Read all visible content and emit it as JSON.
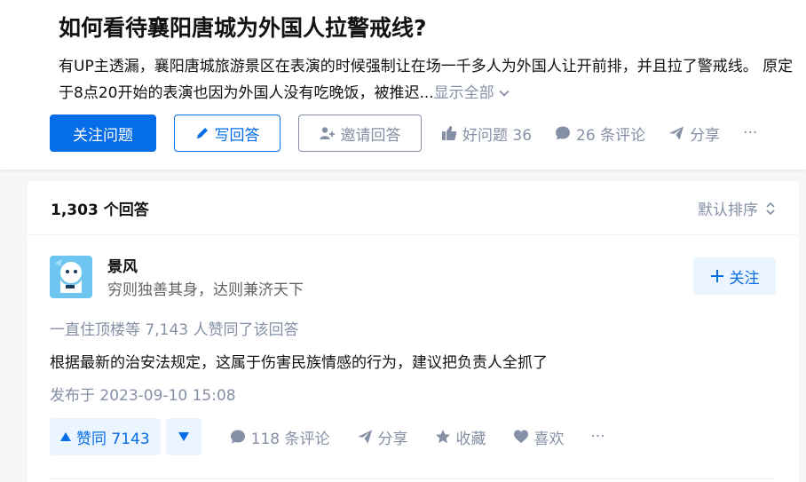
{
  "question": {
    "title": "如何看待襄阳唐城为外国人拉警戒线?",
    "detail": "有UP主透漏，襄阳唐城旅游景区在表演的时候强制让在场一千多人为外国人让开前排，并且拉了警戒线。 原定于8点20开始的表演也因为外国人没有吃晚饭，被推迟...",
    "show_all_label": "显示全部"
  },
  "actions": {
    "follow_question": "关注问题",
    "write_answer": "写回答",
    "invite_answer": "邀请回答",
    "good_question": "好问题 36",
    "comments": "26 条评论",
    "share": "分享",
    "more": "···"
  },
  "answers": {
    "count_label": "1,303 个回答",
    "sort_label": "默认排序"
  },
  "answer": {
    "author_name": "景风",
    "author_bio": "穷则独善其身，达则兼济天下",
    "follow_label": "关注",
    "upvoters_text": "一直住顶楼等 7,143 人赞同了该回答",
    "content": "根据最新的治安法规定，这属于伤害民族情感的行为，建议把负责人全抓了",
    "published": "发布于 2023-09-10 15:08",
    "vote_label": "赞同 7143",
    "comment_label": "118 条评论",
    "share_label": "分享",
    "collect_label": "收藏",
    "like_label": "喜欢",
    "more_label": "···"
  },
  "colors": {
    "brand_blue": "#056de8",
    "light_blue": "#ebf5ff",
    "meta_gray": "#8590a6",
    "text": "#121212",
    "page_bg": "#f6f6f6"
  },
  "icons": {
    "pencil": "pencil-icon",
    "invite": "invite-user-icon",
    "thumb": "thumb-up-icon",
    "comment": "comment-icon",
    "share": "share-icon",
    "more": "more-icon",
    "sort": "sort-icon",
    "plus": "plus-icon",
    "up": "triangle-up-icon",
    "down": "triangle-down-icon",
    "star": "star-icon",
    "heart": "heart-icon",
    "chevron": "chevron-down-icon"
  }
}
